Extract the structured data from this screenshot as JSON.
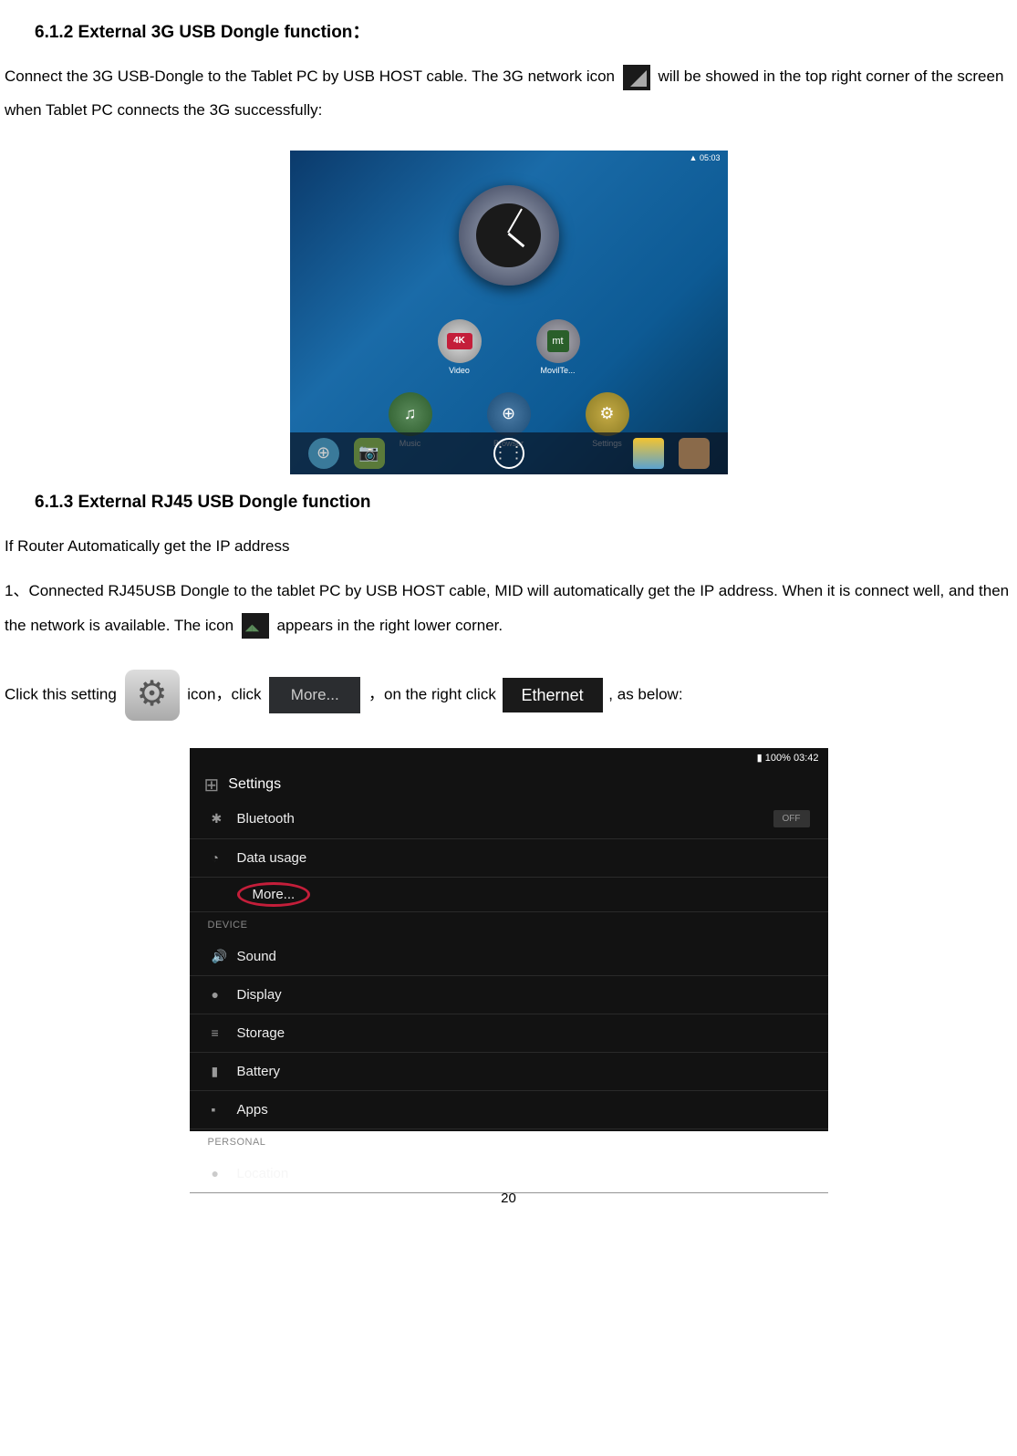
{
  "section_3g": {
    "heading": "6.1.2 External 3G USB Dongle function：",
    "para_pre": "Connect the 3G USB-Dongle to the Tablet PC by USB HOST cable. The 3G network icon ",
    "para_post": " will be showed in the top right corner of the screen when Tablet PC connects the 3G successfully:"
  },
  "screenshot1": {
    "status_time": "05:03",
    "apps_row1": [
      {
        "name": "4K",
        "label": "Video"
      },
      {
        "name": "mt",
        "label": "MovilTe..."
      }
    ],
    "apps_row2": [
      {
        "label": "Music"
      },
      {
        "label": "Browser"
      },
      {
        "label": "Settings"
      }
    ]
  },
  "section_rj45": {
    "heading": "6.1.3 External RJ45 USB Dongle function",
    "sub": "If Router Automatically get the IP address",
    "list_pre": "1、Connected RJ45USB Dongle to the tablet PC by USB HOST cable, MID will automatically get the IP address. When it is connect well, and then the network is available. The icon ",
    "list_post": " appears in the right lower corner.",
    "click_text_1": "Click this setting ",
    "click_text_2": " icon，click ",
    "more_label": "More...",
    "click_text_3": " ，on the right click",
    "ethernet_label": "Ethernet",
    "click_text_4": ", as below:"
  },
  "screenshot2": {
    "status": "100%  03:42",
    "header": "Settings",
    "items": [
      {
        "label": "Bluetooth",
        "toggle": "OFF"
      },
      {
        "label": "Data usage"
      },
      {
        "label_more": "More..."
      },
      {
        "section": "DEVICE"
      },
      {
        "label": "Sound"
      },
      {
        "label": "Display"
      },
      {
        "label": "Storage"
      },
      {
        "label": "Battery"
      },
      {
        "label": "Apps"
      },
      {
        "section": "PERSONAL"
      },
      {
        "label": "Location"
      }
    ]
  },
  "page_number": "20"
}
